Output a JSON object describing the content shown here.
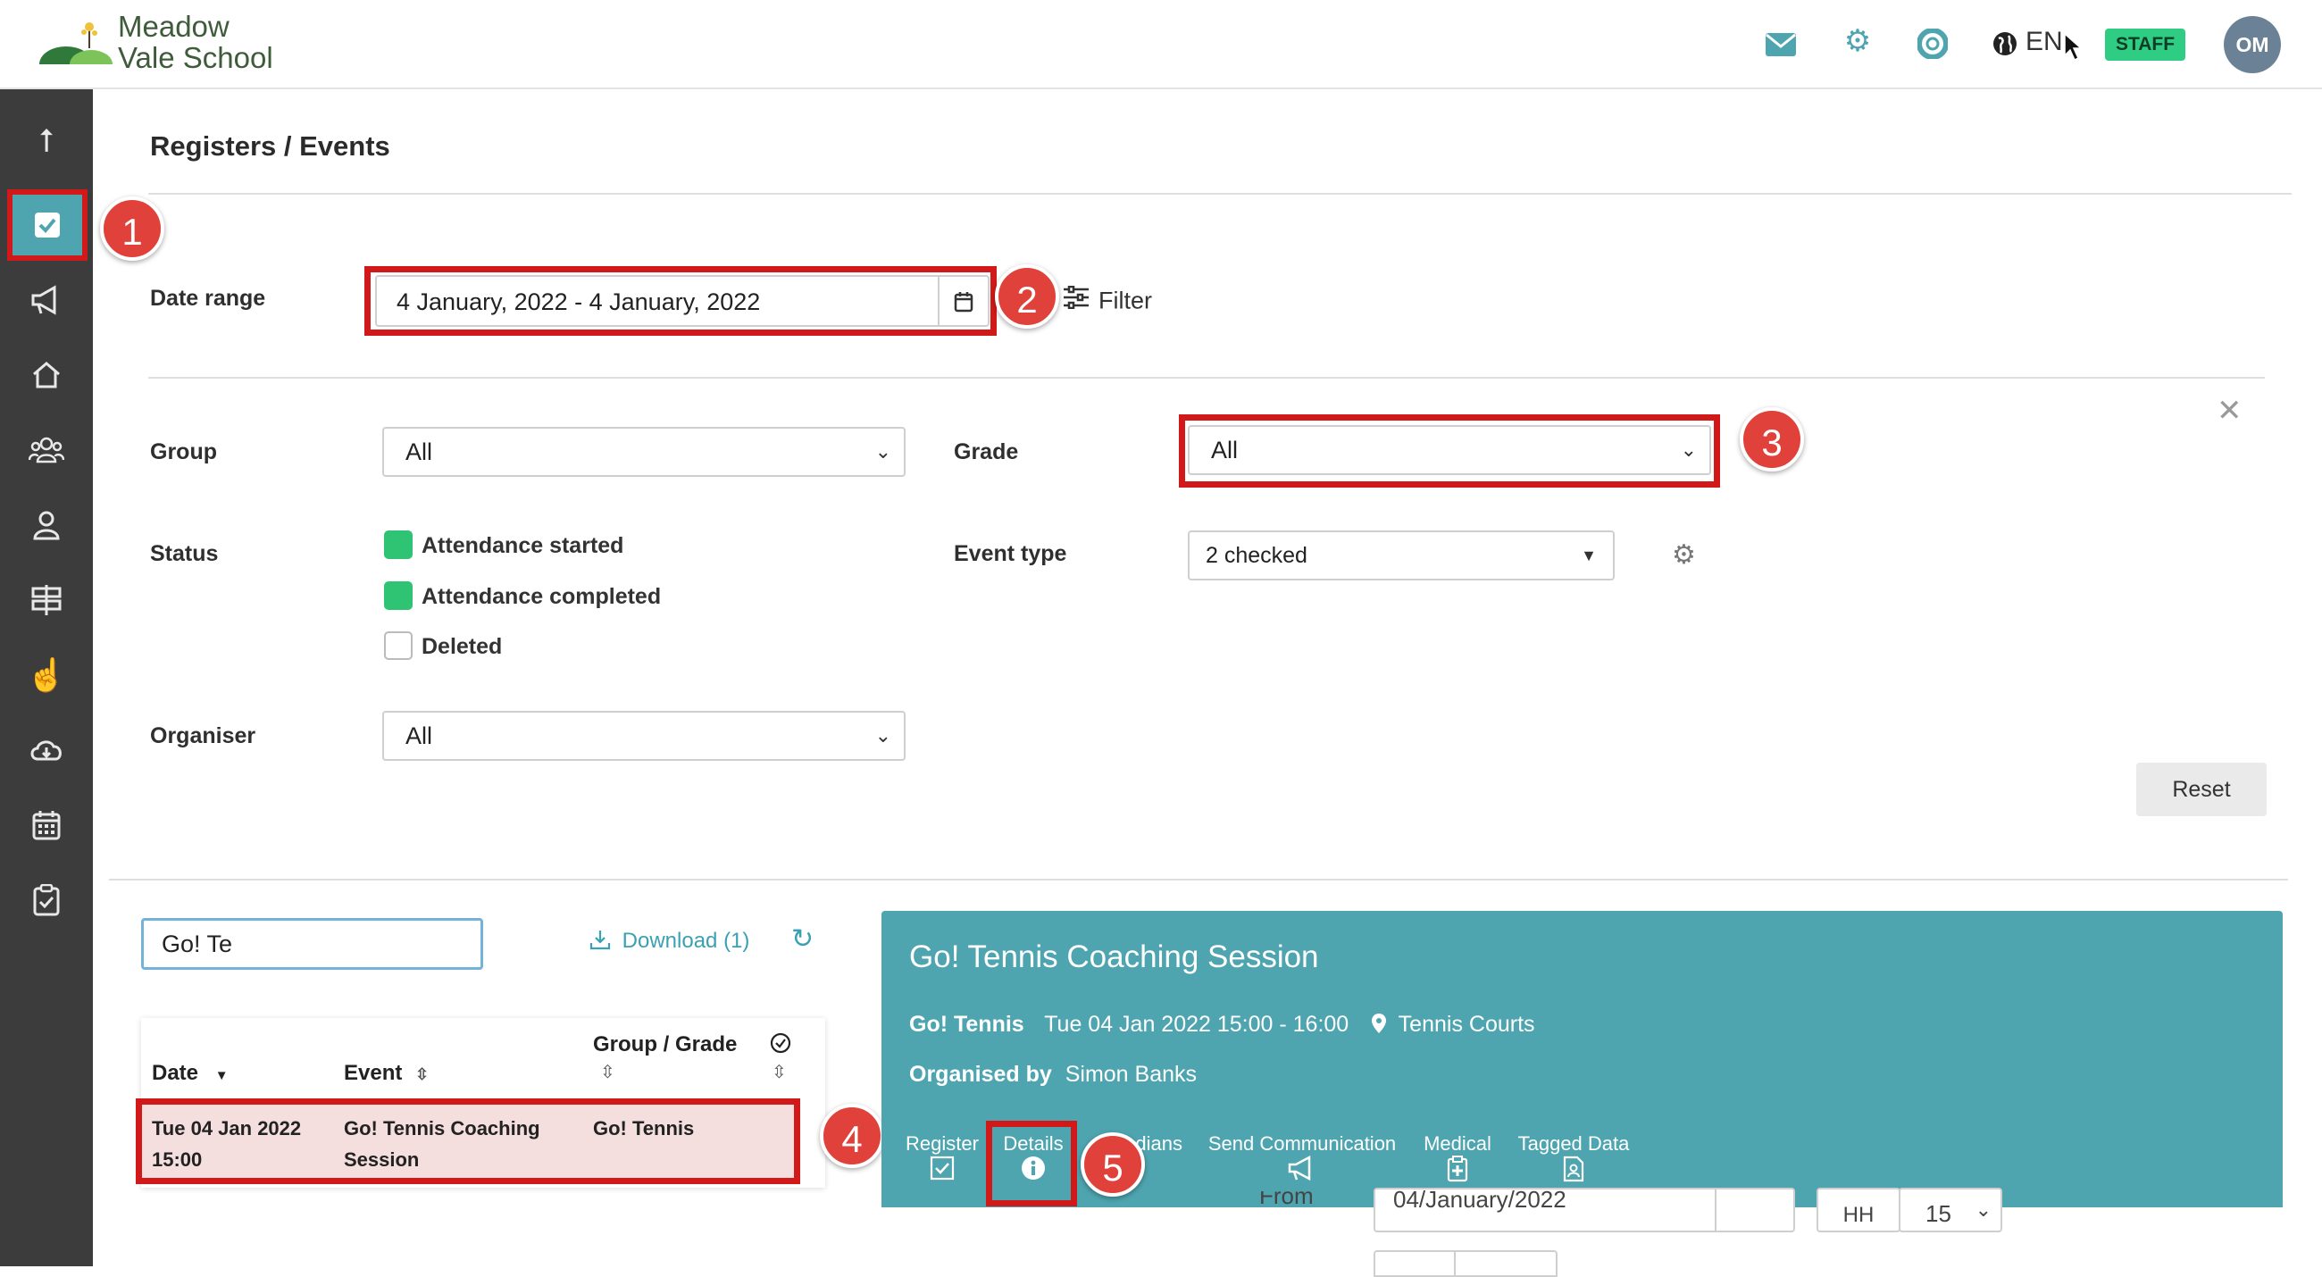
{
  "app": {
    "logo_line1": "Meadow",
    "logo_line2": "Vale School",
    "language": "EN",
    "staff_badge": "STAFF",
    "avatar_initials": "OM"
  },
  "page": {
    "title": "Registers / Events"
  },
  "filters": {
    "date_range_label": "Date range",
    "date_range_value": "4 January, 2022 - 4 January, 2022",
    "filter_label": "Filter",
    "group_label": "Group",
    "group_value": "All",
    "grade_label": "Grade",
    "grade_value": "All",
    "status_label": "Status",
    "status_options": [
      {
        "label": "Attendance started",
        "checked": true
      },
      {
        "label": "Attendance completed",
        "checked": true
      },
      {
        "label": "Deleted",
        "checked": false
      }
    ],
    "event_type_label": "Event type",
    "event_type_value": "2 checked",
    "organiser_label": "Organiser",
    "organiser_value": "All",
    "reset_label": "Reset"
  },
  "list": {
    "search_value": "Go! Te",
    "download_label": "Download (1)",
    "columns": {
      "date": "Date",
      "event": "Event",
      "group_grade": "Group / Grade"
    },
    "rows": [
      {
        "date_line1": "Tue 04 Jan 2022",
        "date_line2": "15:00",
        "event_line1": "Go! Tennis Coaching",
        "event_line2": "Session",
        "group": "Go! Tennis"
      }
    ]
  },
  "detail": {
    "title": "Go! Tennis Coaching Session",
    "group": "Go! Tennis",
    "datetime": "Tue 04 Jan 2022 15:00 - 16:00",
    "location": "Tennis Courts",
    "organised_by_label": "Organised by",
    "organiser": "Simon Banks",
    "tabs": [
      {
        "label": "Register",
        "icon": "checkbox-icon"
      },
      {
        "label": "Details",
        "icon": "info-icon"
      },
      {
        "label": "dians",
        "icon": "guardians-icon"
      },
      {
        "label": "Send Communication",
        "icon": "megaphone-icon"
      },
      {
        "label": "Medical",
        "icon": "medical-icon"
      },
      {
        "label": "Tagged Data",
        "icon": "tagged-data-icon"
      }
    ],
    "from_label": "From",
    "from_date": "04/January/2022",
    "hour_label": "HH",
    "minute_value": "15"
  },
  "callouts": [
    "1",
    "2",
    "3",
    "4",
    "5"
  ],
  "colors": {
    "accent": "#4ea5b0",
    "sidebar": "#3c3c3c",
    "highlight": "#d2191a",
    "staff": "#2fcd84"
  }
}
